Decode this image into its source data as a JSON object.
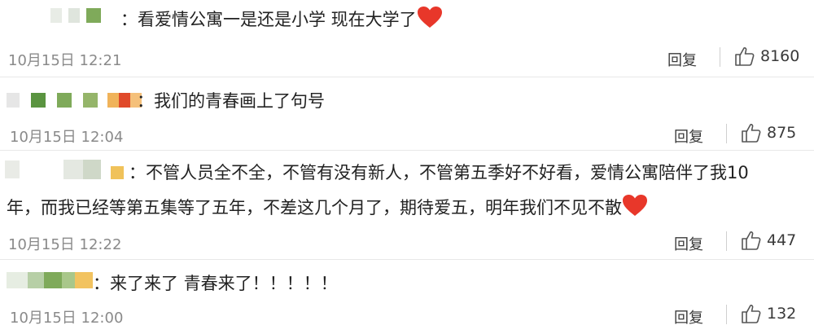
{
  "comments": [
    {
      "text": "：看爱情公寓一是还是小学 现在大学了",
      "time": "10月15日 12:21",
      "reply": "回复",
      "likes": "8160",
      "has_heart": true
    },
    {
      "text": "：我们的青春画上了句号",
      "time": "10月15日 12:04",
      "reply": "回复",
      "likes": "875",
      "has_heart": false
    },
    {
      "text_line1": "：不管人员全不全，不管有没有新人，不管第五季好不好看，爱情公寓陪伴了我10",
      "text_line2": "年，而我已经等第五集等了五年，不差这几个月了，期待爱五，明年我们不见不散",
      "time": "10月15日 12:22",
      "reply": "回复",
      "likes": "447",
      "has_heart": true
    },
    {
      "text": "：来了来了 青春来了！！！！！",
      "time": "10月15日 12:00",
      "reply": "回复",
      "likes": "132",
      "has_heart": false
    }
  ],
  "icons": {
    "like": "thumbs-up-icon",
    "heart": "heart-icon"
  },
  "colors": {
    "heart": "#e8372a",
    "time": "#8a8a8a",
    "text": "#222222"
  }
}
